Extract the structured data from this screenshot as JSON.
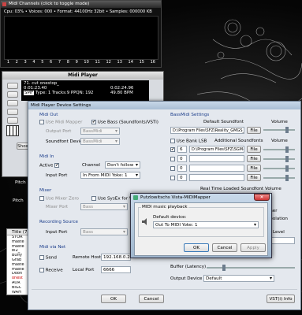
{
  "channels": {
    "title": "Midi Channels (click to toggle mode)",
    "stats": "Cpu: 03% • Voices: 000 • Format: 44100Hz 32bit • Samples: 000000 KB",
    "numbers": [
      "1",
      "2",
      "3",
      "4",
      "5",
      "6",
      "7",
      "8",
      "9",
      "10",
      "11",
      "12",
      "13",
      "14",
      "15",
      "16"
    ]
  },
  "player": {
    "title": "Midi Player",
    "song": "71. cut   onestop_",
    "time": "0:01:23.40",
    "pos": "0:02:24.96",
    "info_prefix": "SMF",
    "info": "Type: 1  Tracks:9  PPQN: 192",
    "bpm": "49.80 BPM",
    "show_all": "Show All",
    "pitch": "Pitch",
    "title_col": "Title (7)",
    "playlist": [
      "STOR",
      "maste",
      "maste",
      "bi2_",
      "Buffy",
      "Grab",
      "maste",
      "maste",
      "Doon",
      "onest",
      "AOR",
      "BIGC",
      "WAH"
    ]
  },
  "settings": {
    "title": "Midi Player Device Settings",
    "midi_out": "Midi Out",
    "use_mapper": "Use Midi Mapper",
    "use_bass": "Use Bass (Soundfonts/VSTi)",
    "output_port": "Output Port",
    "output_port_val": "BassMidi",
    "sf_device": "Soundfont Device",
    "sf_device_val": "BassMidi",
    "midi_in": "Midi In",
    "active": "Active",
    "channel": "Channel",
    "channel_val": "Don't follow",
    "input_port": "Input Port",
    "input_port_val": "In From MIDI Yoke:  1",
    "mixer": "Mixer",
    "use_mixer_zero": "Use Mixer Zero",
    "use_sysex": "Use SysEx for Volu",
    "mixer_port": "Mixer Port",
    "mixer_port_val": "Bass",
    "recording": "Recording Source",
    "rec_input_port": "Input Port",
    "rec_input_val": "Bass",
    "midi_net": "Midi via Net",
    "send": "Send",
    "remote_host": "Remote Host",
    "remote_host_val": "192.168.0.254",
    "receive": "Receive",
    "local_port": "Local Port",
    "local_port_val": "6666",
    "bassmidi": "BassMidi Settings",
    "default_sf": "Default Soundfont",
    "volume": "Volume",
    "sf_path": "D:\\Program Files\\SFZ\\Reality_GMGS_falcon",
    "file": "File",
    "use_bank_lsb": "Use Bank LSB",
    "additional_sf": "Additional Soundfonts",
    "bank_rows": [
      {
        "n": "6",
        "path": "D:\\Program Files\\SFZ\\SGM-V2"
      },
      {
        "n": "0",
        "path": ""
      },
      {
        "n": "0",
        "path": ""
      },
      {
        "n": "0",
        "path": ""
      }
    ],
    "rt_loaded": "Real Time Loaded Soundfont Volume",
    "right_partial": [
      "rner",
      "rpolation",
      "Level"
    ],
    "buffer": "Buffer (Latency)",
    "output_device": "Output Device",
    "output_device_val": "Default",
    "ok": "OK",
    "cancel": "Cancel",
    "vsti_info": "VST(i) Info"
  },
  "mapper": {
    "title": "Putzlowitschs Vista-MIDIMapper",
    "group": "MIDI music playback",
    "default_device": "Default device:",
    "device_val": "Out To MIDI Yoke:  1",
    "ok": "OK",
    "cancel": "Cancel",
    "apply": "Apply"
  }
}
